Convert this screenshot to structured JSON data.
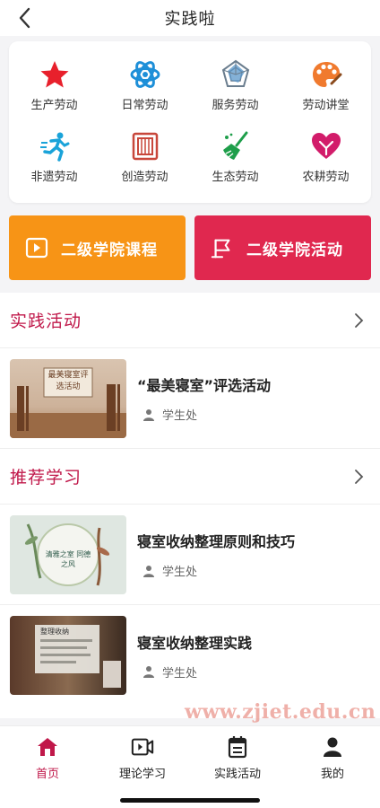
{
  "header": {
    "title": "实践啦"
  },
  "categories": [
    {
      "label": "生产劳动",
      "icon": "star-icon"
    },
    {
      "label": "日常劳动",
      "icon": "atom-icon"
    },
    {
      "label": "服务劳动",
      "icon": "radar-icon"
    },
    {
      "label": "劳动讲堂",
      "icon": "palette-icon"
    },
    {
      "label": "非遗劳动",
      "icon": "runner-icon"
    },
    {
      "label": "创造劳动",
      "icon": "film-icon"
    },
    {
      "label": "生态劳动",
      "icon": "broom-icon"
    },
    {
      "label": "农耕劳动",
      "icon": "heart-icon"
    }
  ],
  "banners": {
    "course": {
      "label": "二级学院课程",
      "color": "#f79416",
      "icon": "play-icon"
    },
    "activity": {
      "label": "二级学院活动",
      "color": "#e0284f",
      "icon": "flag-icon"
    }
  },
  "practice": {
    "title": "实践活动",
    "items": [
      {
        "title": "“最美寝室”评选活动",
        "author": "学生处",
        "thumb_text": "最美寝室评选活动"
      }
    ]
  },
  "recommend": {
    "title": "推荐学习",
    "items": [
      {
        "title": "寝室收纳整理原则和技巧",
        "author": "学生处",
        "thumb_text": "清雅之室 同德之风"
      },
      {
        "title": "寝室收纳整理实践",
        "author": "学生处",
        "thumb_text": "整理收纳"
      }
    ]
  },
  "watermark": "www.zjiet.edu.cn",
  "tabbar": {
    "tabs": [
      {
        "label": "首页",
        "icon": "home-icon",
        "active": true
      },
      {
        "label": "理论学习",
        "icon": "video-icon",
        "active": false
      },
      {
        "label": "实践活动",
        "icon": "calendar-icon",
        "active": false
      },
      {
        "label": "我的",
        "icon": "person-icon",
        "active": false
      }
    ],
    "active_color": "#c0184a"
  }
}
